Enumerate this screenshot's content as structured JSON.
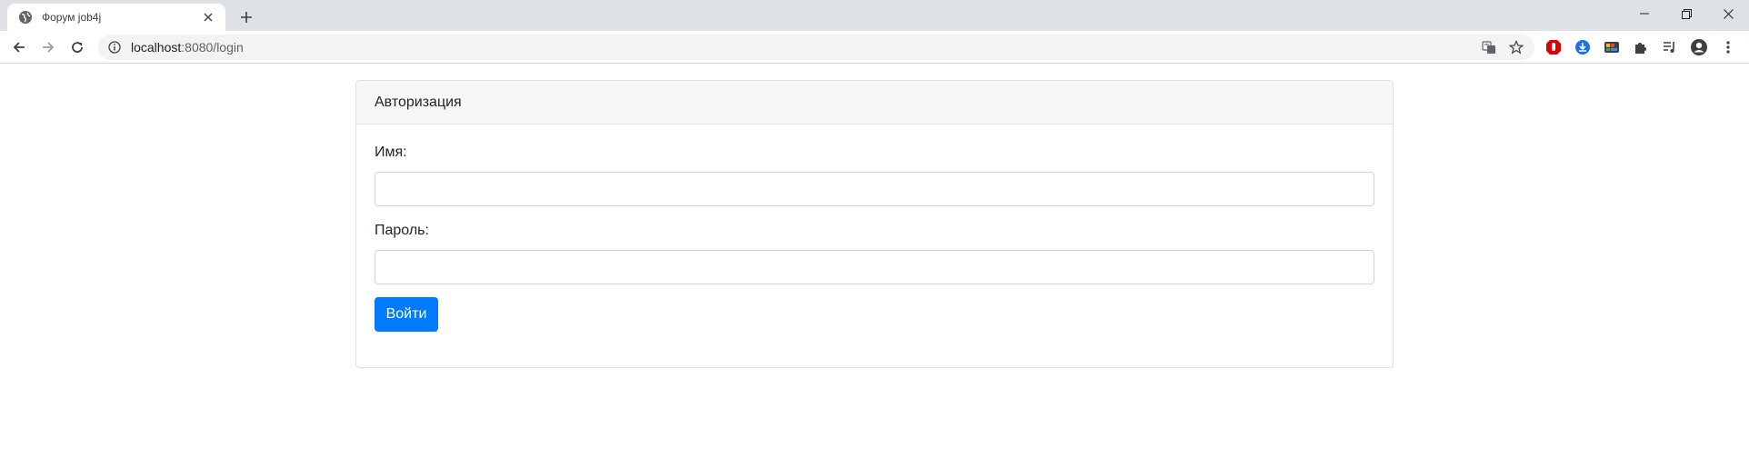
{
  "browser": {
    "tab": {
      "title": "Форум job4j",
      "favicon": "globe-icon",
      "close": "close-icon"
    },
    "url": {
      "host": "localhost",
      "path": ":8080/login"
    },
    "colors": {
      "tabstrip": "#dee1e6",
      "omnibox": "#f1f3f4"
    }
  },
  "page": {
    "card_header": "Авторизация",
    "name_label": "Имя:",
    "name_value": "",
    "password_label": "Пароль:",
    "password_value": "",
    "submit_label": "Войти",
    "colors": {
      "primary": "#007bff",
      "card_header_bg": "#f7f7f7",
      "border": "#dfdfdf"
    }
  }
}
